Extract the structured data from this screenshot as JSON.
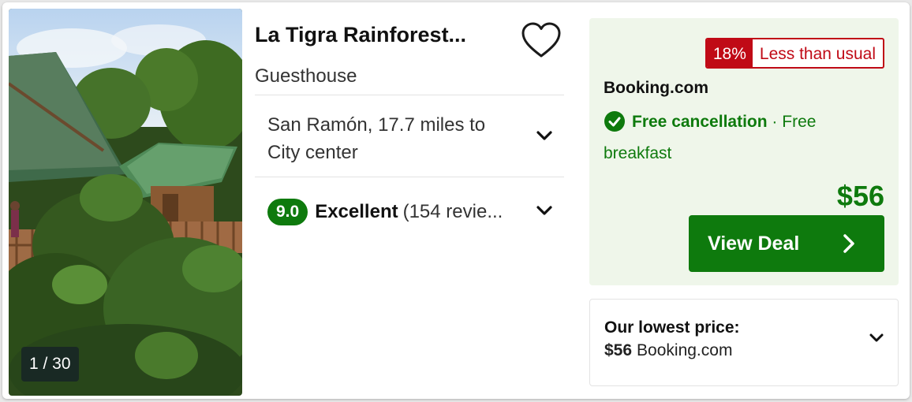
{
  "listing": {
    "title": "La Tigra Rainforest...",
    "type": "Guesthouse",
    "location": "San Ramón, 17.7 miles to City center",
    "photo_counter": "1 / 30",
    "rating": {
      "score": "9.0",
      "label": "Excellent",
      "reviews": "(154 revie..."
    }
  },
  "deal": {
    "discount_percent": "18%",
    "discount_label": "Less than usual",
    "provider": "Booking.com",
    "cancellation": "Free cancellation",
    "extras": "· Free breakfast",
    "price": "$56",
    "button_label": "View Deal"
  },
  "lowest_price": {
    "title": "Our lowest price:",
    "price": "$56",
    "provider": "Booking.com"
  },
  "colors": {
    "brand_green": "#0e7a0d",
    "deal_bg": "#eff6ea",
    "discount_red": "#c00a16"
  },
  "icons": [
    "heart-icon",
    "chevron-down-icon",
    "check-circle-icon",
    "chevron-right-icon"
  ]
}
